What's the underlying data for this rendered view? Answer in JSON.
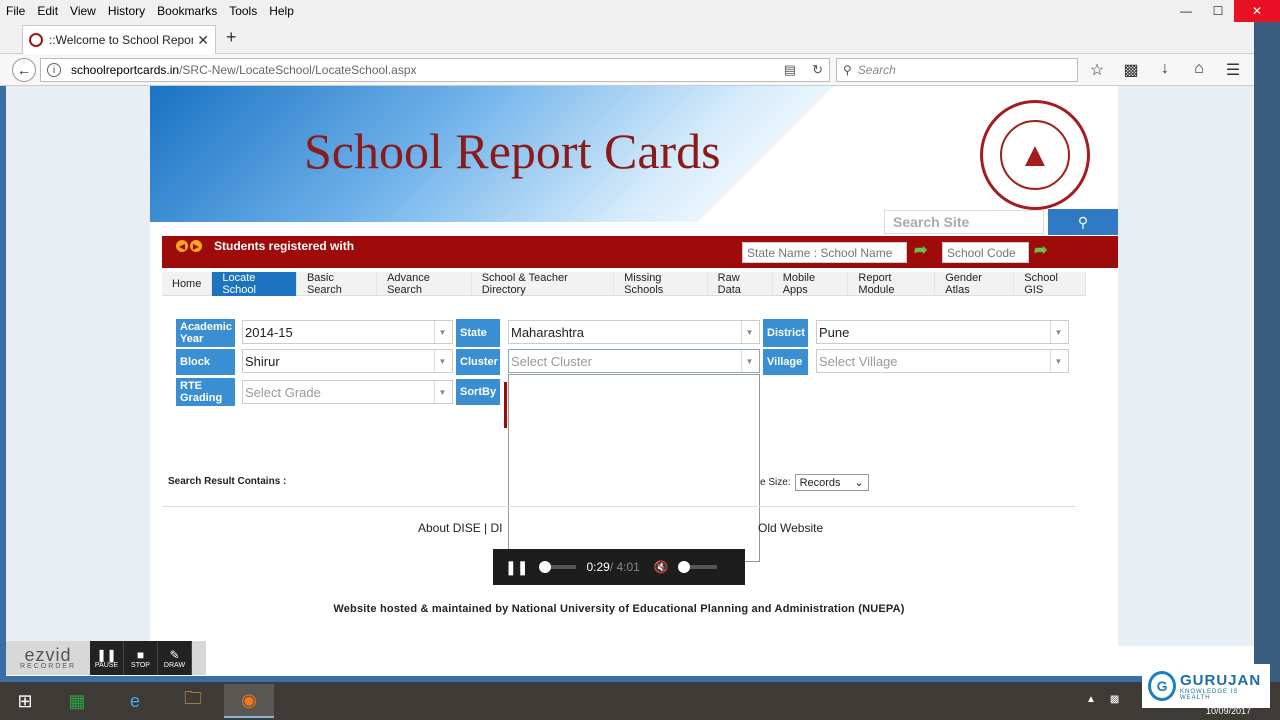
{
  "browser": {
    "menu": [
      "File",
      "Edit",
      "View",
      "History",
      "Bookmarks",
      "Tools",
      "Help"
    ],
    "tab_title": "::Welcome to School Report",
    "url_host": "schoolreportcards.in",
    "url_path": "/SRC-New/LocateSchool/LocateSchool.aspx",
    "search_placeholder": "Search"
  },
  "banner": {
    "title": "School Report Cards",
    "site_search_placeholder": "Search Site"
  },
  "redbar": {
    "marquee": "Students registered with",
    "state_school_placeholder": "State Name : School Name",
    "school_code_placeholder": "School Code"
  },
  "nav": [
    "Home",
    "Locate School",
    "Basic Search",
    "Advance Search",
    "School & Teacher Directory",
    "Missing Schools",
    "Raw Data",
    "Mobile Apps",
    "Report Module",
    "Gender Atlas",
    "School GIS"
  ],
  "nav_active": "Locate School",
  "filters": {
    "academic_year_label": "Academic Year",
    "academic_year": "2014-15",
    "state_label": "State",
    "state": "Maharashtra",
    "district_label": "District",
    "district": "Pune",
    "block_label": "Block",
    "block": "Shirur",
    "cluster_label": "Cluster",
    "cluster_placeholder": "Select Cluster",
    "village_label": "Village",
    "village_placeholder": "Select Village",
    "rte_label": "RTE Grading",
    "rte_placeholder": "Select Grade",
    "sortby_label": "SortBy"
  },
  "results": {
    "contains_label": "Search Result Contains :",
    "page_size_label": "e Size:",
    "page_size_value": "Records"
  },
  "footer": {
    "links": "About DISE   | DI",
    "old_site": "Old Website",
    "hosted": "Website hosted & maintained by National University of Educational Planning and Administration (NUEPA)"
  },
  "video": {
    "current": "0:29",
    "duration": " / 4:01",
    "progress_fraction": 0.12
  },
  "ezvid": {
    "brand": "ezvid",
    "sub": "RECORDER",
    "pause": "PAUSE",
    "stop": "STOP",
    "draw": "DRAW"
  },
  "watermark": {
    "name": "GURUJAN",
    "tagline": "KNOWLEDGE IS WEALTH"
  },
  "clock": "10/09/2017"
}
